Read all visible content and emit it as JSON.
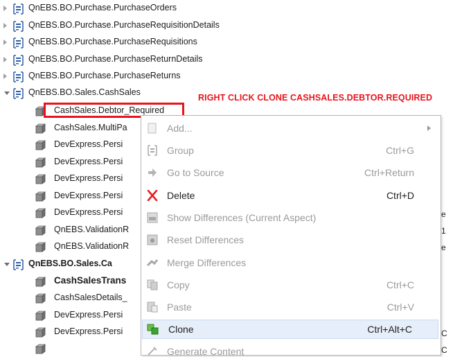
{
  "tree": {
    "rows": [
      {
        "label": "QnEBS.BO.Purchase.PurchaseOrders",
        "kind": "namespace",
        "state": "collapsed"
      },
      {
        "label": "QnEBS.BO.Purchase.PurchaseRequisitionDetails",
        "kind": "namespace",
        "state": "collapsed"
      },
      {
        "label": "QnEBS.BO.Purchase.PurchaseRequisitions",
        "kind": "namespace",
        "state": "collapsed"
      },
      {
        "label": "QnEBS.BO.Purchase.PurchaseReturnDetails",
        "kind": "namespace",
        "state": "collapsed"
      },
      {
        "label": "QnEBS.BO.Purchase.PurchaseReturns",
        "kind": "namespace",
        "state": "collapsed"
      },
      {
        "label": "QnEBS.BO.Sales.CashSales",
        "kind": "namespace",
        "state": "expanded"
      },
      {
        "label": "CashSales.Debtor_Required",
        "kind": "item"
      },
      {
        "label": "CashSales.MultiPa",
        "kind": "item"
      },
      {
        "label": "DevExpress.Persi",
        "kind": "item"
      },
      {
        "label": "DevExpress.Persi",
        "kind": "item"
      },
      {
        "label": "DevExpress.Persi",
        "kind": "item"
      },
      {
        "label": "DevExpress.Persi",
        "kind": "item"
      },
      {
        "label": "DevExpress.Persi",
        "kind": "item"
      },
      {
        "label": "QnEBS.ValidationR",
        "kind": "item"
      },
      {
        "label": "QnEBS.ValidationR",
        "kind": "item"
      },
      {
        "label": "QnEBS.BO.Sales.Ca",
        "kind": "namespace",
        "state": "expanded",
        "bold": true
      },
      {
        "label": "CashSalesTrans",
        "kind": "item",
        "bold": true
      },
      {
        "label": "CashSalesDetails_",
        "kind": "item"
      },
      {
        "label": "DevExpress.Persi",
        "kind": "item"
      },
      {
        "label": "DevExpress.Persi",
        "kind": "item"
      }
    ]
  },
  "annotation": {
    "text": "RIGHT CLICK CLONE CASHSALES.DEBTOR.REQUIRED",
    "color": "#e8141c"
  },
  "context_menu": {
    "items": [
      {
        "label": "Add...",
        "shortcut": "",
        "icon": "add-icon",
        "disabled": true,
        "has_submenu": true
      },
      {
        "label": "Group",
        "shortcut": "Ctrl+G",
        "icon": "group-icon",
        "disabled": true
      },
      {
        "label": "Go to Source",
        "shortcut": "Ctrl+Return",
        "icon": "go-to-source-icon",
        "disabled": true
      },
      {
        "label": "Delete",
        "shortcut": "Ctrl+D",
        "icon": "delete-icon",
        "disabled": false
      },
      {
        "label": "Show Differences (Current Aspect)",
        "shortcut": "",
        "icon": "show-differences-icon",
        "disabled": true
      },
      {
        "label": "Reset Differences",
        "shortcut": "",
        "icon": "reset-differences-icon",
        "disabled": true
      },
      {
        "label": "Merge Differences",
        "shortcut": "",
        "icon": "merge-differences-icon",
        "disabled": true
      },
      {
        "label": "Copy",
        "shortcut": "Ctrl+C",
        "icon": "copy-icon",
        "disabled": true
      },
      {
        "label": "Paste",
        "shortcut": "Ctrl+V",
        "icon": "paste-icon",
        "disabled": true
      },
      {
        "label": "Clone",
        "shortcut": "Ctrl+Alt+C",
        "icon": "clone-icon",
        "disabled": false,
        "selected": true
      },
      {
        "label": "Generate Content",
        "shortcut": "",
        "icon": "generate-content-icon",
        "disabled": true
      }
    ]
  },
  "colors": {
    "annotation": "#e8141c",
    "selection": "#e5eef9",
    "disabled_text": "#9a9a9a",
    "delete_icon": "#e02020",
    "clone_icon": "#3aa62e"
  }
}
